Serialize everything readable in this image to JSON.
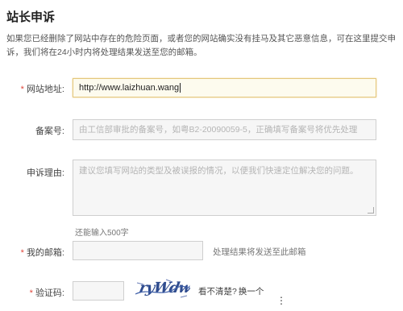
{
  "page": {
    "title": "站长申诉",
    "intro": "如果您已经删除了网站中存在的危险页面，或者您的网站确实没有挂马及其它恶意信息，可在这里提交申诉，我们将在24小时内将处理结果发送至您的邮箱。"
  },
  "form": {
    "required_mark": "*",
    "url": {
      "label": "网站地址:",
      "value": "http://www.laizhuan.wang"
    },
    "icp": {
      "label": "备案号:",
      "placeholder": "由工信部审批的备案号，如粤B2-20090059-5，正确填写备案号将优先处理"
    },
    "reason": {
      "label": "申诉理由:",
      "placeholder": "建议您填写网站的类型及被误报的情况，以便我们快速定位解决您的问题。",
      "counter": "还能输入500字"
    },
    "email": {
      "label": "我的邮箱:",
      "hint": "处理结果将发送至此邮箱"
    },
    "captcha": {
      "label": "验证码:",
      "image_text": "ryWdw",
      "prompt": "看不清楚?",
      "refresh": "换一个"
    }
  },
  "colors": {
    "required": "#e0473c",
    "focus_border": "#e4c67a",
    "captcha_ink": "#2f4c8f"
  }
}
